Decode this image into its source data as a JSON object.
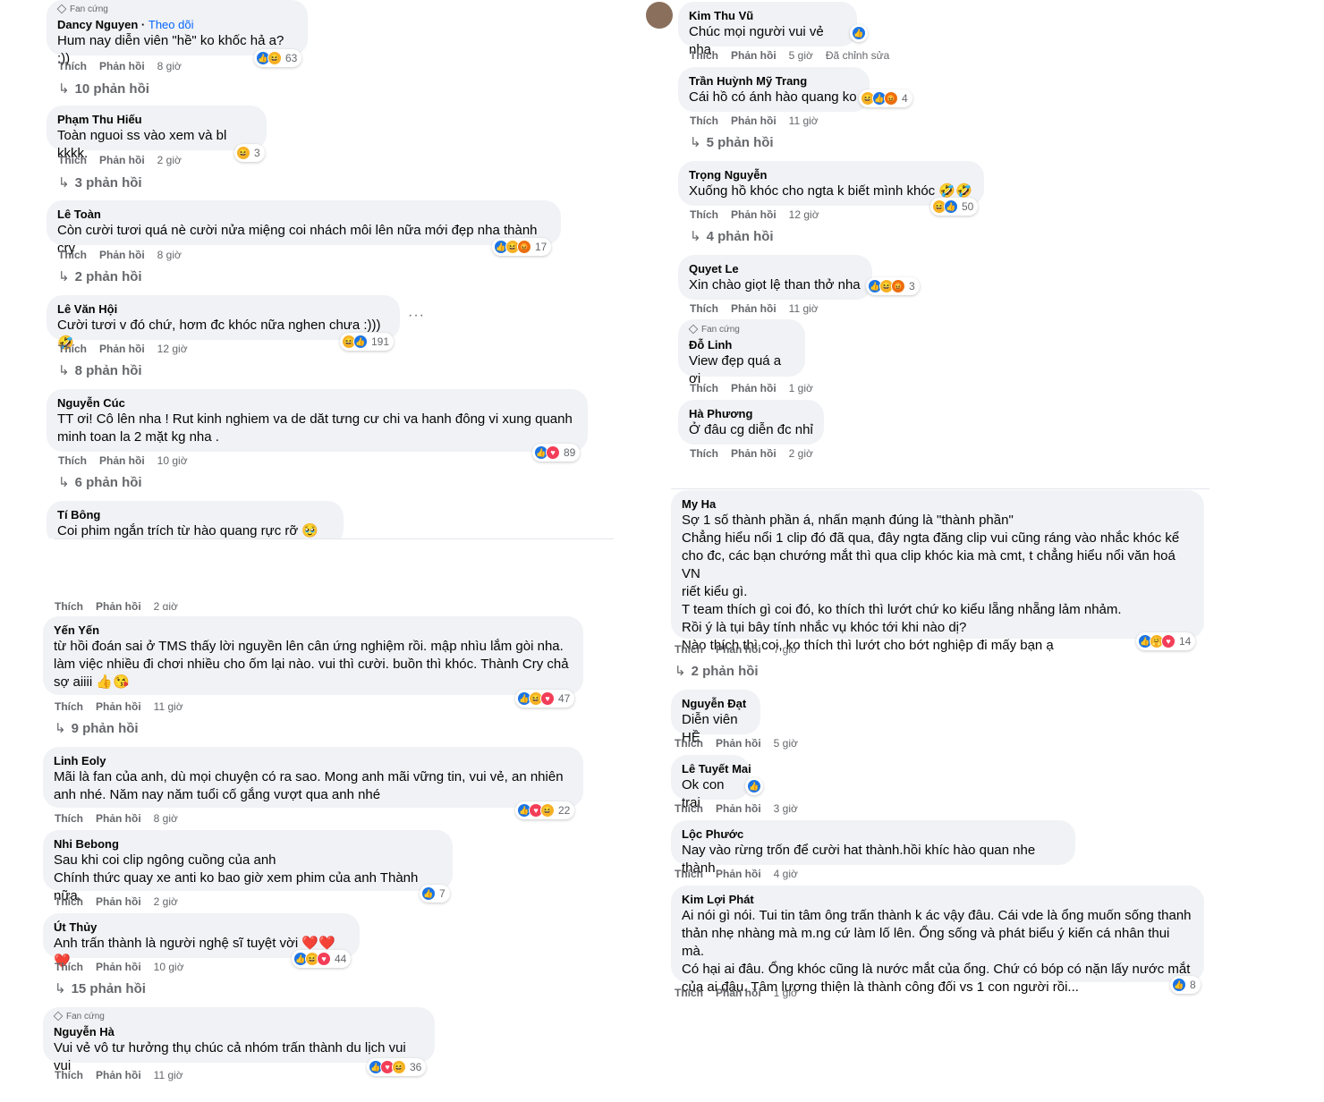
{
  "labels": {
    "like": "Thích",
    "reply": "Phản hồi",
    "fan_badge": "Fan cứng",
    "follow": "Theo dõi",
    "edited": "Đã chỉnh sửa",
    "more": "···"
  },
  "left": [
    {
      "name": "Dancy Nguyen",
      "fan": true,
      "follow": true,
      "text": "Hum nay diễn viên \"hề\" ko khốc hả a? :))",
      "time": "8 giờ",
      "reactions": [
        "like",
        "haha"
      ],
      "count": "63",
      "replies": "10 phản hồi"
    },
    {
      "name": "Phạm Thu Hiếu",
      "text": "Toàn nguoi ss vào xem và bl kkkk.",
      "time": "2 giờ",
      "reactions": [
        "haha"
      ],
      "count": "3",
      "replies": "3 phản hồi"
    },
    {
      "name": "Lê Toàn",
      "text": "Còn cười tươi quá nè cười nửa miệng coi nhách môi lên nữa mới đẹp nha thành cry",
      "time": "8 giờ",
      "reactions": [
        "like",
        "haha",
        "angry"
      ],
      "count": "17",
      "replies": "2 phản hồi"
    },
    {
      "name": "Lê Văn Hội",
      "text": "Cười tươi v đó chứ, hơm đc khóc nữa nghen chưa :))) 🤣",
      "time": "12 giờ",
      "reactions": [
        "haha",
        "like"
      ],
      "count": "191",
      "replies": "8 phản hồi"
    },
    {
      "name": "Nguyễn Cúc",
      "text": "TT ơi! Cô lên nha ! Rut kinh nghiem va de dăt tưng cư chi va hanh đông vi xung quanh\nminh toan la 2 mặt kg nha .",
      "time": "10 giờ",
      "reactions": [
        "like",
        "love"
      ],
      "count": "89",
      "replies": "6 phản hồi"
    },
    {
      "name": "Tí Bông",
      "text": "Coi phim ngắn trích từ hào quang rực rỡ 🥹🥹"
    },
    {
      "name": "Yến Yến",
      "text": "từ hồi đoán sai ở TMS thấy lời nguyền lên cân ứng nghiệm rồi. mập nhìu lắm gòi nha.\nlàm việc nhiều đi chơi nhiều cho ốm lại nào. vui thì cười. buồn thì khóc. Thành Cry chả\nsợ aiiii 👍😘",
      "time": "11 giờ",
      "reactions": [
        "like",
        "haha",
        "love"
      ],
      "count": "47",
      "replies": "9 phản hồi"
    },
    {
      "name": "Linh Eoly",
      "text": "Mãi là fan của anh, dù mọi chuyện có ra sao. Mong anh mãi vững tin, vui vẻ, an nhiên\nanh nhé. Năm nay năm tuổi cố gắng vượt qua anh nhé",
      "time": "8 giờ",
      "reactions": [
        "like",
        "love",
        "haha"
      ],
      "count": "22"
    },
    {
      "name": "Nhi Bebong",
      "text": "Sau khi coi clip ngông cuồng của anh\nChính thức quay xe anti ko bao giờ xem phim của anh Thành nữa.",
      "time": "2 giờ",
      "reactions": [
        "like"
      ],
      "count": "7"
    },
    {
      "name": "Út Thủy",
      "text": "Anh trấn thành là người nghệ sĩ tuyệt vời ❤️❤️❤️",
      "time": "10 giờ",
      "reactions": [
        "like",
        "haha",
        "love"
      ],
      "count": "44",
      "replies": "15 phản hồi"
    },
    {
      "name": "Nguyễn Hà",
      "fan": true,
      "text": "Vui vẻ vô tư hưởng thụ chúc cả nhóm trấn thành du lịch vui vui",
      "time": "11 giờ",
      "reactions": [
        "like",
        "love",
        "haha"
      ],
      "count": "36"
    }
  ],
  "right": [
    {
      "name": "Kim Thu Vũ",
      "text": "Chúc mọi người vui vẻ nha",
      "time": "5 giờ",
      "edited": true,
      "reactions": [
        "like"
      ]
    },
    {
      "name": "Trần Huỳnh Mỹ Trang",
      "text": "Cái hồ có ánh hào quang ko",
      "time": "11 giờ",
      "reactions": [
        "haha",
        "like",
        "angry"
      ],
      "count": "4",
      "replies": "5 phản hồi"
    },
    {
      "name": "Trọng Nguyễn",
      "text": "Xuống hồ khóc cho ngta k biết mình khóc 🤣🤣",
      "time": "12 giờ",
      "reactions": [
        "haha",
        "like"
      ],
      "count": "50",
      "replies": "4 phản hồi"
    },
    {
      "name": "Quyet Le",
      "text": "Xin chào giọt lệ than thở nha",
      "time": "11 giờ",
      "reactions": [
        "like",
        "haha",
        "angry"
      ],
      "count": "3"
    },
    {
      "name": "Đỗ Linh",
      "fan": true,
      "text": "View đẹp quá a ơi",
      "time": "1 giờ"
    },
    {
      "name": "Hà Phương",
      "text": "Ở đâu cg diễn đc nhỉ",
      "time": "2 giờ"
    },
    {
      "name": "My Ha",
      "text": "Sợ 1 số thành phần á, nhấn mạnh đúng là \"thành phần\"\nChẳng hiểu nổi 1 clip đó đã qua, đây ngta đăng clip vui cũng ráng vào nhắc khóc kể\ncho đc, các bạn chướng mắt thì qua clip khóc kia mà cmt, t chẳng hiểu nổi văn hoá VN\nriết kiểu gì.\nT team thích gì coi đó, ko thích thì lướt chứ ko kiểu lẵng nhẵng lảm nhảm.\nRồi ý là tụi bây tính nhắc vụ khóc tới khi nào dị?\nNào thích thì coi, ko thích thì lướt cho bớt nghiệp đi mấy bạn ạ",
      "time": "7 giờ",
      "reactions": [
        "like",
        "care",
        "love"
      ],
      "count": "14",
      "replies": "2 phản hồi"
    },
    {
      "name": "Nguyễn Đạt",
      "text": "Diễn viên HỀ",
      "time": "5 giờ"
    },
    {
      "name": "Lê Tuyết Mai",
      "text": "Ok con trai",
      "time": "3 giờ",
      "reactions": [
        "like"
      ]
    },
    {
      "name": "Lộc Phước",
      "text": "Nay vào rừng trốn để cười hat thành.hồi khíc hào quan nhe thành.",
      "time": "4 giờ"
    },
    {
      "name": "Kim Lợi Phát",
      "text": "Ai nói gì nói. Tui tin tâm ông trấn thành k ác vậy đâu. Cái vde là ổng muốn sống thanh\nthản nhẹ nhàng mà m.ng cứ làm lố lên. Ổng sống và phát biểu ý kiến cá nhân thui mà.\nCó hại ai đâu. Ổng khóc cũng là nước mắt của ổng. Chứ có bóp có nặn lấy nước mắt\ncủa ai đâu. Tâm lương thiện là thành công đối vs 1 con người rồi...",
      "time": "1 giờ",
      "reactions": [
        "like"
      ],
      "count": "8"
    }
  ],
  "partial_actions": {
    "time": "2 giờ"
  }
}
